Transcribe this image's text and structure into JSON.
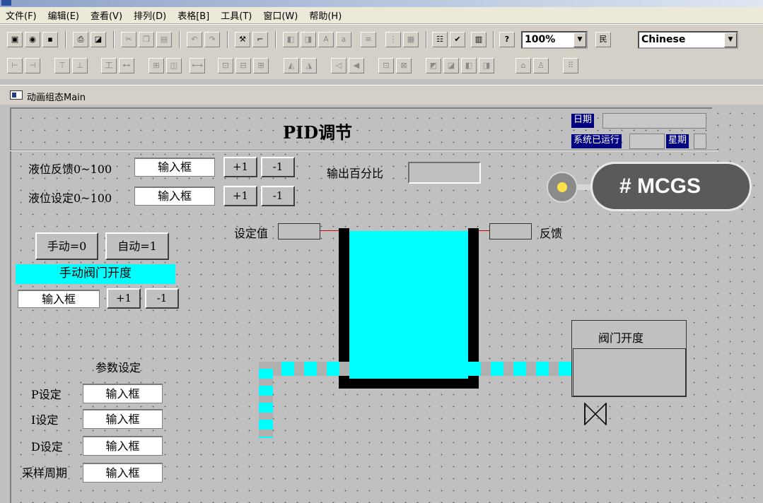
{
  "menu": [
    "文件(F)",
    "编辑(E)",
    "查看(V)",
    "排列(D)",
    "表格[B]",
    "工具(T)",
    "窗口(W)",
    "帮助(H)"
  ],
  "toolbar": {
    "zoom": "100%",
    "language": "Chinese",
    "row1_icons": [
      "window-icon",
      "open-icon",
      "save-icon",
      "print-icon",
      "print-preview-icon",
      "cut-icon",
      "copy-icon",
      "paste-icon",
      "undo-icon",
      "redo-icon",
      "tools-icon",
      "component-icon",
      "fill-icon",
      "line-color-icon",
      "font-icon",
      "text-color-icon",
      "align-grid-icon",
      "grid-icon",
      "properties-icon",
      "check-icon",
      "script-icon",
      "help-icon"
    ],
    "row2_icons": [
      "align-left-icon",
      "align-right-icon",
      "align-top-icon",
      "align-bottom-icon",
      "center-h-icon",
      "center-v-icon",
      "same-width-icon",
      "same-height-icon",
      "same-size-icon",
      "space-h-icon",
      "space-v-icon",
      "flip-h-icon",
      "flip-v-icon",
      "rotate-left-icon",
      "rotate-right-icon",
      "group-icon",
      "ungroup-icon",
      "bring-front-icon",
      "send-back-icon",
      "forward-icon",
      "backward-icon",
      "lock-icon",
      "unlock-icon",
      "grid-dots-icon"
    ]
  },
  "window": {
    "title": "动画组态Main"
  },
  "screen": {
    "title": "PID调节",
    "date_label": "日期",
    "runtime_label": "系统已运行",
    "weekday_label": "星期",
    "feedback_label": "液位反馈0~100",
    "setpoint_label": "液位设定0~100",
    "input_placeholder": "输入框",
    "plus_label": "+1",
    "minus_label": "-1",
    "output_label": "输出百分比",
    "manual_button": "手动=0",
    "auto_button": "自动=1",
    "manual_valve_label": "手动阀门开度",
    "setpoint_tag": "设定值",
    "feedback_tag": "反馈",
    "valve_opening_label": "阀门开度",
    "params_title": "参数设定",
    "p_label": "P设定",
    "i_label": "I设定",
    "d_label": "D设定",
    "sample_label": "采样周期"
  },
  "tag": {
    "text": "# MCGS"
  },
  "colors": {
    "tank": "#00ffff",
    "nav": "#000080",
    "canvas": "#c0c0c0"
  }
}
